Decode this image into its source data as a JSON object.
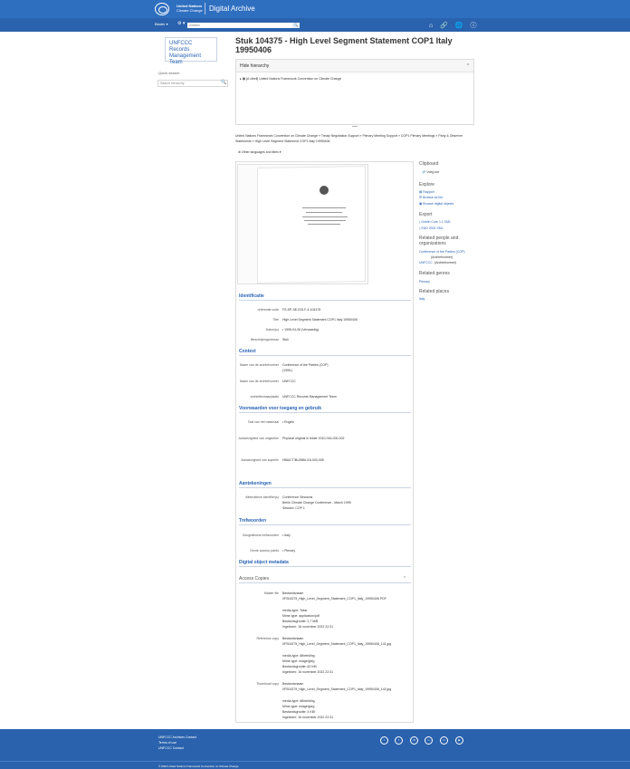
{
  "header": {
    "org_line1": "United Nations",
    "org_line2": "Climate Change",
    "app_title": "Digital Archive"
  },
  "nav": {
    "browse_label": "Blader ▾",
    "gear_label": "⚙ ▾",
    "search_placeholder": "Zoeken",
    "search_btn": "🔍",
    "icons": "⌂ 🔗 🌐 ⓘ"
  },
  "sidebar_left": {
    "repo_name": "UNFCCC Records Management Team",
    "quick_search_label": "Quick search",
    "quick_search_placeholder": "Search hierarchy"
  },
  "record": {
    "title": "Stuk 104375 - High Level Segment Statement COP1 Italy 19950406",
    "hierarchy_header": "Hide hierarchy",
    "hierarchy_item": "▸ ▦ [A vitrell] United Nations Framework Convention on Climate Change",
    "breadcrumb": "United Nations Framework Convention on Climate Change  »  Treaty Negotiation Support  »  Plenary Meeting Support  »  COP1 Plenary Meetings  »  Party & Observer Statements  »  High Level Segment Statement COP1 Italy 19950406",
    "other_languages": "⊕ Other languages and titles ▾"
  },
  "sections": {
    "identificatie": "Identificatie",
    "context": "Context",
    "voorwaarden": "Voorwaarden voor toegang en gebruik",
    "aantekeningen": "Aantekeningen",
    "trefwoorden": "Trefwoorden",
    "digital_meta": "Digital object metadata",
    "access_copies": "Access Copies"
  },
  "fields": {
    "refcode_lbl": "referentie code",
    "refcode_val": "FS-SP-SE-ISS-F-4-104375",
    "titel_lbl": "Titel",
    "titel_val": "High Level Segment Statement COP1 Italy 19950406",
    "datum_lbl": "Datum(s)",
    "datum_val": "• 1995-04-06 (Vervaardig)",
    "niveau_lbl": "Beschrijvingsniveau",
    "niveau_val": "Stuk",
    "archiefvormer_lbl": "Naam van de archiefvormer",
    "archiefvormer_val": "Conference of the Parties (COP)",
    "archiefvormer_dates": "(1995-)",
    "archiefvormer2_lbl": "Naam van de archiefvormer",
    "archiefvormer2_val": "UNFCCC",
    "archiefbewaarplaats_lbl": "archiefbewaarplaats",
    "archiefbewaarplaats_val": "UNFCCC Records Management Team",
    "taal_lbl": "Taal van het materiaal",
    "taal_val": "• Engels",
    "ligging1_lbl": "Aanwezigheid van originelen",
    "ligging1_val": "Physical original in folder 2010-016-000-002",
    "ligging2_lbl": "Aanwezigheid van kopieën",
    "ligging2_val": "HB&ICT/BU/MBL/18-003-005",
    "alt_lbl": "Alternatieve identifier(s)",
    "alt_val1": "Conference Sessions",
    "alt_val2": "Berlin Climate Change Conference - March 1995",
    "alt_val3": "Session: COP 1",
    "geo_lbl": "Geografische trefwoorden",
    "geo_val": "• Italy",
    "genre_lbl": "Genre access points",
    "genre_val": "• Plenary"
  },
  "access_copies": {
    "master_lbl": "Master file",
    "master_name": "Bestandsnaam",
    "master_file": "0FS04375_High_Level_Segment_Statement_COP1_Italy_19950406.PDF",
    "master_media": "media-type: Tekst",
    "master_mime": "Mime-type: application/pdf",
    "master_size": "Bestandsgrootte: 2,7 MiB",
    "master_date": "Ingelezen: 16 november 2022 22:31",
    "ref_lbl": "Reference copy",
    "ref_name": "Bestandsnaam",
    "ref_file": "0FS04375_High_Level_Segment_Statement_COP1_Italy_19950406_141.jpg",
    "ref_media": "media-type: Afbeelding",
    "ref_mime": "Mime-type: image/jpeg",
    "ref_size": "Bestandsgrootte: 62 KiB",
    "ref_date": "Ingelezen: 16 november 2022 22:31",
    "thumb_lbl": "Thumbnail copy",
    "thumb_name": "Bestandsnaam",
    "thumb_file": "0FS04375_High_Level_Segment_Statement_COP1_Italy_19950406_142.jpg",
    "thumb_media": "media-type: Afbeelding",
    "thumb_mime": "Mime-type: image/jpeg",
    "thumb_size": "Bestandsgrootte: 4 KiB",
    "thumb_date": "Ingelezen: 16 november 2022 22:31"
  },
  "right_sidebar": {
    "clipboard_h": "Clipboard",
    "clipboard_add": "Voeg toe",
    "explore_h": "Explore",
    "explore_1": "▤ Rapport",
    "explore_2": "☰ Browse as list",
    "explore_3": "▣ Browse digital objects",
    "export_h": "Export",
    "export_1": "⤓ Dublin Core 1.1 XML",
    "export_2": "⤓ EAD 2002 XML",
    "people_h": "Related people and organizations",
    "people_1": "Conference of the Parties (COP)",
    "people_1_role": "(Archiefvormer)",
    "people_2": "UNFCCC",
    "people_2_role": "(Archiefvormer)",
    "genres_h": "Related genres",
    "genres_1": "Plenary",
    "places_h": "Related places",
    "places_1": "Italy"
  },
  "footer": {
    "link1": "UNFCCC Archives Contact",
    "link2": "Terms of use",
    "link3": "UNFCCC Contact",
    "copyright": "© 2024 United Nations Framework Convention on Climate Change"
  },
  "colors": {
    "header_blue": "#2f6fc0",
    "footer_blue": "#2a62ad",
    "link_blue": "#2a64b5"
  }
}
